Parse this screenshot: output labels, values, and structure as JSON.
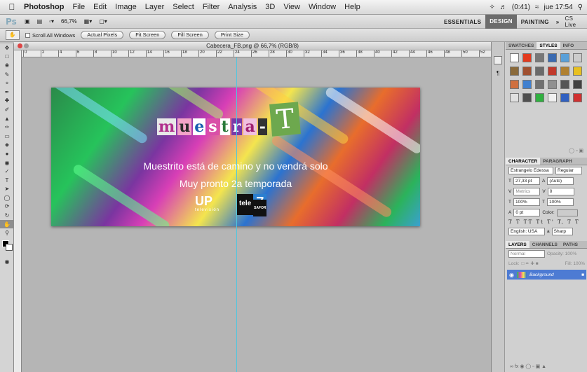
{
  "menubar": {
    "items": [
      "Photoshop",
      "File",
      "Edit",
      "Image",
      "Layer",
      "Select",
      "Filter",
      "Analysis",
      "3D",
      "View",
      "Window",
      "Help"
    ],
    "status": {
      "battery": "(0:41)",
      "clock": "jue 17:54"
    }
  },
  "appbar": {
    "logo": "Ps",
    "zoom": "66,7%",
    "workspaces": [
      "ESSENTIALS",
      "DESIGN",
      "PAINTING"
    ],
    "active_workspace": "DESIGN",
    "more": "»",
    "cslive": "CS Live"
  },
  "options": {
    "scroll_all": "Scroll All Windows",
    "buttons": [
      "Actual Pixels",
      "Fit Screen",
      "Fill Screen",
      "Print Size"
    ]
  },
  "document": {
    "title": "Cabecera_FB.png @ 66,7% (RGB/8)",
    "ruler_labels": [
      "0",
      "2",
      "4",
      "6",
      "8",
      "10",
      "12",
      "14",
      "16",
      "18",
      "20",
      "22",
      "24",
      "26",
      "28",
      "30",
      "32",
      "34",
      "36",
      "38",
      "40",
      "42",
      "44",
      "46",
      "48",
      "50",
      "52"
    ]
  },
  "banner": {
    "title_letters": [
      "m",
      "u",
      "e",
      "s",
      "t",
      "r",
      "a",
      "-"
    ],
    "title_T": "T",
    "line1": "Muestrito está de camino y no vendrá solo",
    "line2": "Muy pronto 2a temporada",
    "logo_up": "UP",
    "logo_up_sub": "televisión",
    "logo_tele": "tele",
    "logo_7": "7",
    "logo_safor": "SAFOR"
  },
  "panels": {
    "swatch_tabs": [
      "SWATCHES",
      "STYLES",
      "INFO"
    ],
    "active_swatch_tab": "STYLES",
    "styles_colors": [
      "#ffffff",
      "#e33a1e",
      "#777777",
      "#3a6ab0",
      "#5aa0d8",
      "#cccccc",
      "#8a6a3a",
      "#a05030",
      "#6a6a6a",
      "#c0392b",
      "#b08030",
      "#e8c020",
      "#d07040",
      "#4080d0",
      "#707070",
      "#909090",
      "#555555",
      "#404040",
      "#e0e0e0",
      "#505050",
      "#30b040",
      "#f0f0f0",
      "#3060c0",
      "#d03030"
    ],
    "char_tabs": [
      "CHARACTER",
      "PARAGRAPH"
    ],
    "font": "Estrangelo Edessa",
    "style": "Regular",
    "size": "27,33 pt",
    "leading": "(Auto)",
    "kerning": "Metrics",
    "tracking": "0",
    "vscale": "100%",
    "hscale": "100%",
    "baseline": "0 pt",
    "color_label": "Color:",
    "lang": "English: USA",
    "aa": "Sharp",
    "layer_tabs": [
      "LAYERS",
      "CHANNELS",
      "PATHS"
    ],
    "blend": "Normal",
    "opacity": "Opacity: 100%",
    "lock": "Lock:",
    "fill": "Fill: 100%",
    "layer_name": "Background"
  }
}
